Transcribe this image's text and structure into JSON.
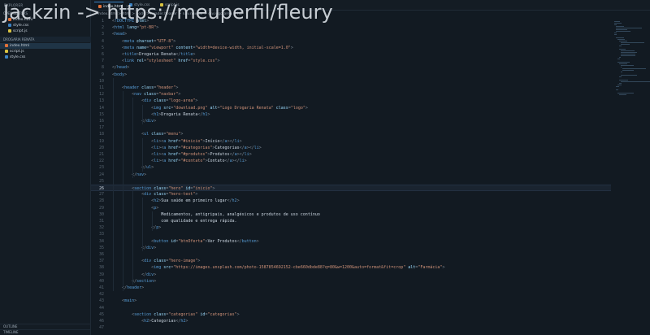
{
  "watermark": "Jackzin -> https://meuperfil/fleury",
  "sidebar": {
    "title": "EXPLORER",
    "section_open": "OPEN EDITORS",
    "open_editors": [
      {
        "label": "index.html",
        "color": "#e0723a"
      },
      {
        "label": "style.css",
        "color": "#3b82c4"
      },
      {
        "label": "script.js",
        "color": "#d9c341"
      }
    ],
    "section_project": "DROGARIA RENATA",
    "files": [
      {
        "label": "index.html",
        "color": "#e0723a",
        "selected": true
      },
      {
        "label": "script.js",
        "color": "#d9c341",
        "selected": false
      },
      {
        "label": "style.css",
        "color": "#3b82c4",
        "selected": false
      }
    ],
    "outline": "OUTLINE",
    "timeline": "TIMELINE"
  },
  "tabs": [
    {
      "label": "index.html",
      "color": "#e0723a",
      "active": true
    },
    {
      "label": "style.css",
      "color": "#3b82c4",
      "active": false
    },
    {
      "label": "script.js",
      "color": "#d9c341",
      "active": false
    }
  ],
  "breadcrumb": "index.html > html > body > header.header > nav.navbar > div.logo-area > h1",
  "editor": {
    "current_line": 26,
    "lines": [
      {
        "n": 1,
        "text": "<!DOCTYPE html>"
      },
      {
        "n": 2,
        "text": "<html lang=\"pt-BR\">"
      },
      {
        "n": 3,
        "text": "<head>"
      },
      {
        "n": 4,
        "text": "    <meta charset=\"UTF-8\">"
      },
      {
        "n": 5,
        "text": "    <meta name=\"viewport\" content=\"width=device-width, initial-scale=1.0\">"
      },
      {
        "n": 6,
        "text": "    <title>Drogaria Renata</title>"
      },
      {
        "n": 7,
        "text": "    <link rel=\"stylesheet\" href=\"style.css\">"
      },
      {
        "n": 8,
        "text": "</head>"
      },
      {
        "n": 9,
        "text": "<body>"
      },
      {
        "n": 10,
        "text": ""
      },
      {
        "n": 11,
        "text": "    <header class=\"header\">"
      },
      {
        "n": 12,
        "text": "        <nav class=\"navbar\">"
      },
      {
        "n": 13,
        "text": "            <div class=\"logo-area\">"
      },
      {
        "n": 14,
        "text": "                <img src=\"download.png\" alt=\"Logo Drogaria Renata\" class=\"logo\">"
      },
      {
        "n": 15,
        "text": "                <h1>Drogaria Renata</h1>"
      },
      {
        "n": 16,
        "text": "            </div>"
      },
      {
        "n": 17,
        "text": ""
      },
      {
        "n": 18,
        "text": "            <ul class=\"menu\">"
      },
      {
        "n": 19,
        "text": "                <li><a href=\"#inicio\">Início</a></li>"
      },
      {
        "n": 20,
        "text": "                <li><a href=\"#categorias\">Categorias</a></li>"
      },
      {
        "n": 21,
        "text": "                <li><a href=\"#produtos\">Produtos</a></li>"
      },
      {
        "n": 22,
        "text": "                <li><a href=\"#contato\">Contato</a></li>"
      },
      {
        "n": 23,
        "text": "            </ul>"
      },
      {
        "n": 24,
        "text": "        </nav>"
      },
      {
        "n": 25,
        "text": ""
      },
      {
        "n": 26,
        "text": "        <section class=\"hero\" id=\"inicio\">"
      },
      {
        "n": 27,
        "text": "            <div class=\"hero-text\">"
      },
      {
        "n": 28,
        "text": "                <h2>Sua saúde em primeiro lugar</h2>"
      },
      {
        "n": 29,
        "text": "                <p>"
      },
      {
        "n": 30,
        "text": "                    Medicamentos, antigripais, analgésicos e produtos de uso contínuo"
      },
      {
        "n": 31,
        "text": "                    com qualidade e entrega rápida."
      },
      {
        "n": 32,
        "text": "                </p>"
      },
      {
        "n": 33,
        "text": ""
      },
      {
        "n": 34,
        "text": "                <button id=\"btnOferta\">Ver Produtos</button>"
      },
      {
        "n": 35,
        "text": "            </div>"
      },
      {
        "n": 36,
        "text": ""
      },
      {
        "n": 37,
        "text": "            <div class=\"hero-image\">"
      },
      {
        "n": 38,
        "text": "                <img src=\"https://images.unsplash.com/photo-1587854692152-cbe660dbde88?q=80&w=1200&auto=format&fit=crop\" alt=\"Farmácia\">"
      },
      {
        "n": 39,
        "text": "            </div>"
      },
      {
        "n": 40,
        "text": "        </section>"
      },
      {
        "n": 41,
        "text": "    </header>"
      },
      {
        "n": 42,
        "text": ""
      },
      {
        "n": 43,
        "text": "    <main>"
      },
      {
        "n": 44,
        "text": ""
      },
      {
        "n": 45,
        "text": "        <section class=\"categorias\" id=\"categorias\">"
      },
      {
        "n": 46,
        "text": "            <h2>Categorias</h2>"
      },
      {
        "n": 47,
        "text": ""
      }
    ]
  },
  "colors": {
    "tag": "#569cd6",
    "attr": "#9cdcfe",
    "string": "#ce9178",
    "text": "#c9d4df",
    "punct": "#808b96"
  }
}
